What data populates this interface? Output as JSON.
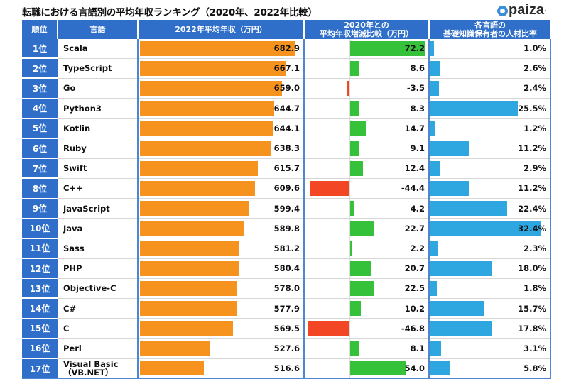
{
  "title": "転職における言語別の平均年収ランキング（2020年、2022年比較）",
  "logo": {
    "text": "paiza",
    "icon": "paiza-logo-icon"
  },
  "headers": {
    "rank": "順位",
    "language": "言語",
    "salary": "2022年平均年収（万円）",
    "diff_line1": "2020年との",
    "diff_line2": "平均年収増減比較（万円）",
    "ratio_line1": "各言語の",
    "ratio_line2": "基礎知識保有者の人材比率"
  },
  "colors": {
    "header": "#2f6fc9",
    "salary_bar": "#f5931e",
    "increase_bar": "#36c13b",
    "decrease_bar": "#f34624",
    "ratio_bar": "#2ea6e0"
  },
  "chart_data": {
    "type": "table",
    "title": "転職における言語別の平均年収ランキング（2020年、2022年比較）",
    "columns": [
      "順位",
      "言語",
      "2022年平均年収（万円）",
      "2020年との平均年収増減比較（万円）",
      "各言語の基礎知識保有者の人材比率"
    ],
    "rows": [
      {
        "rank": "1位",
        "language": "Scala",
        "salary": 682.9,
        "diff": 72.2,
        "ratio": 1.0
      },
      {
        "rank": "2位",
        "language": "TypeScript",
        "salary": 667.1,
        "diff": 8.6,
        "ratio": 2.6
      },
      {
        "rank": "3位",
        "language": "Go",
        "salary": 659.0,
        "diff": -3.5,
        "ratio": 2.4
      },
      {
        "rank": "4位",
        "language": "Python3",
        "salary": 644.7,
        "diff": 8.3,
        "ratio": 25.5
      },
      {
        "rank": "5位",
        "language": "Kotlin",
        "salary": 644.1,
        "diff": 14.7,
        "ratio": 1.2
      },
      {
        "rank": "6位",
        "language": "Ruby",
        "salary": 638.3,
        "diff": 9.1,
        "ratio": 11.2
      },
      {
        "rank": "7位",
        "language": "Swift",
        "salary": 615.7,
        "diff": 12.4,
        "ratio": 2.9
      },
      {
        "rank": "8位",
        "language": "C++",
        "salary": 609.6,
        "diff": -44.4,
        "ratio": 11.2
      },
      {
        "rank": "9位",
        "language": "JavaScript",
        "salary": 599.4,
        "diff": 4.2,
        "ratio": 22.4
      },
      {
        "rank": "10位",
        "language": "Java",
        "salary": 589.8,
        "diff": 22.7,
        "ratio": 32.4
      },
      {
        "rank": "11位",
        "language": "Sass",
        "salary": 581.2,
        "diff": 2.2,
        "ratio": 2.3
      },
      {
        "rank": "12位",
        "language": "PHP",
        "salary": 580.4,
        "diff": 20.7,
        "ratio": 18.0
      },
      {
        "rank": "13位",
        "language": "Objective-C",
        "salary": 578.0,
        "diff": 22.5,
        "ratio": 1.8
      },
      {
        "rank": "14位",
        "language": "C#",
        "salary": 577.9,
        "diff": 10.2,
        "ratio": 15.7
      },
      {
        "rank": "15位",
        "language": "C",
        "salary": 569.5,
        "diff": -46.8,
        "ratio": 17.8
      },
      {
        "rank": "16位",
        "language": "Perl",
        "salary": 527.6,
        "diff": 8.1,
        "ratio": 3.1
      },
      {
        "rank": "17位",
        "language": "Visual Basic（VB.NET）",
        "salary": 516.6,
        "diff": 54.0,
        "ratio": 5.8
      }
    ],
    "salary_range": [
      0,
      682.9
    ],
    "diff_range": [
      -50,
      72.2
    ],
    "ratio_range": [
      0,
      32.4
    ],
    "ratio_unit": "%"
  }
}
